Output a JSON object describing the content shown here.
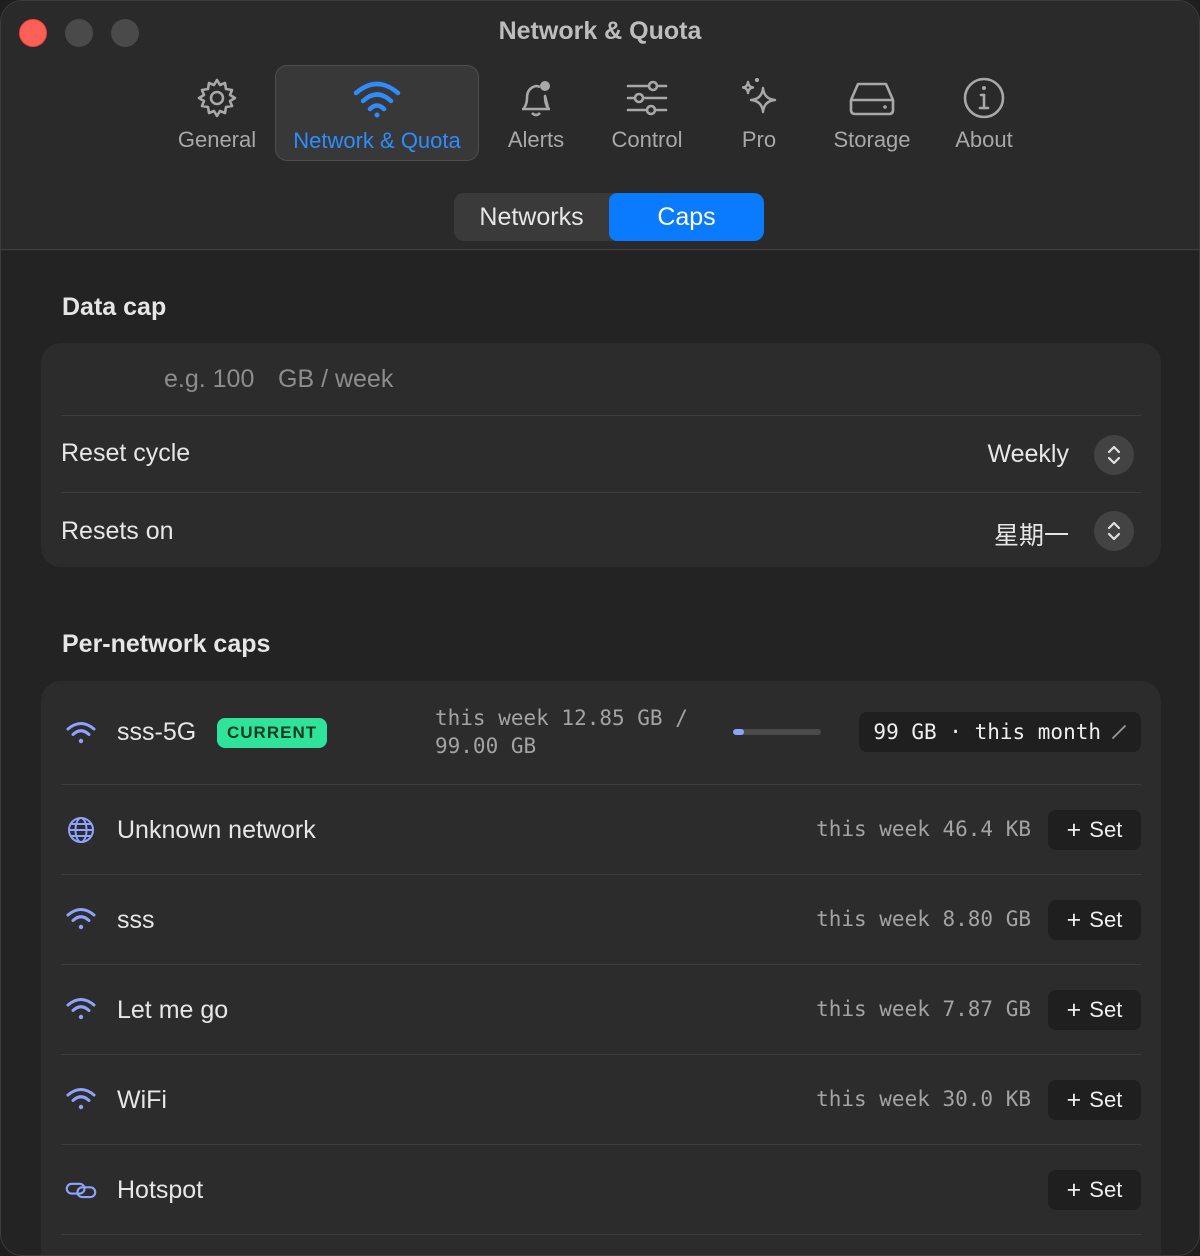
{
  "window": {
    "title": "Network & Quota"
  },
  "toolbar": {
    "items": [
      {
        "label": "General",
        "icon": "gear-icon"
      },
      {
        "label": "Network & Quota",
        "icon": "wifi-icon"
      },
      {
        "label": "Alerts",
        "icon": "bell-icon"
      },
      {
        "label": "Control",
        "icon": "sliders-icon"
      },
      {
        "label": "Pro",
        "icon": "sparkles-icon"
      },
      {
        "label": "Storage",
        "icon": "drive-icon"
      },
      {
        "label": "About",
        "icon": "info-icon"
      }
    ],
    "active": "Network & Quota"
  },
  "tabs": {
    "networks": "Networks",
    "caps": "Caps",
    "selected": "Caps"
  },
  "data_cap": {
    "section_title": "Data cap",
    "placeholder": "e.g. 100",
    "unit": "GB / week",
    "reset_cycle_label": "Reset cycle",
    "reset_cycle_value": "Weekly",
    "resets_on_label": "Resets on",
    "resets_on_value": "星期一"
  },
  "per_network": {
    "section_title": "Per-network caps",
    "networks": [
      {
        "name": "sss-5G",
        "type": "wifi",
        "badge": "CURRENT",
        "usage": "this week 12.85 GB / 99.00 GB",
        "progress": 0.13,
        "cap": "99 GB · this month",
        "edit_icon": "pencil-icon"
      },
      {
        "name": "Unknown network",
        "type": "globe",
        "usage": "this week 46.4 KB",
        "action": "Set"
      },
      {
        "name": "sss",
        "type": "wifi",
        "usage": "this week 8.80 GB",
        "action": "Set"
      },
      {
        "name": "Let me go",
        "type": "wifi",
        "usage": "this week 7.87 GB",
        "action": "Set"
      },
      {
        "name": "WiFi",
        "type": "wifi",
        "usage": "this week 30.0 KB",
        "action": "Set"
      },
      {
        "name": "Hotspot",
        "type": "link",
        "usage": "",
        "action": "Set"
      }
    ]
  },
  "colors": {
    "accent": "#0a7bff",
    "badge": "#2fe39a",
    "wifi_icon": "#8fa2ff"
  }
}
